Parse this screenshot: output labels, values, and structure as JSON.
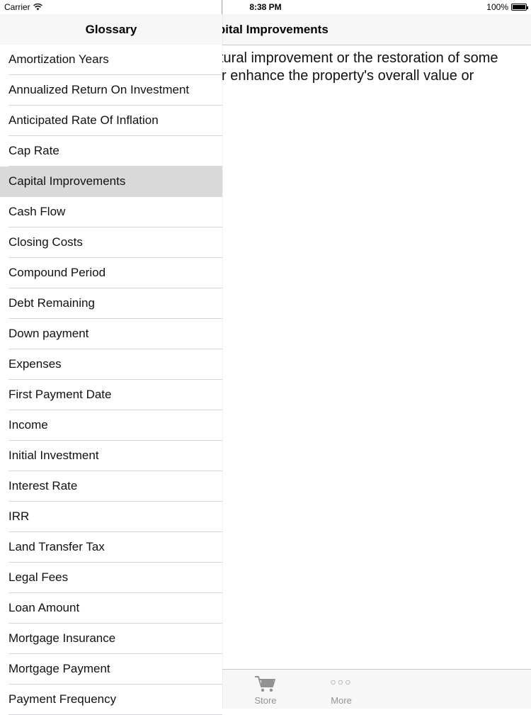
{
  "status_bar": {
    "carrier": "Carrier",
    "time": "8:38 PM",
    "battery": "100%"
  },
  "detail": {
    "title": "Capital Improvements",
    "title_visible": "pital Improvements",
    "body_line1": "tural improvement or the restoration of some",
    "body_line2": "r enhance the property's overall value or"
  },
  "tab_bar": {
    "store_label": "Store",
    "more_label": "More",
    "inactive_color": "#929292"
  },
  "glossary": {
    "title": "Glossary",
    "selected_index": 4,
    "items": [
      {
        "label": "Amortization Years"
      },
      {
        "label": "Annualized Return On Investment"
      },
      {
        "label": "Anticipated Rate Of Inflation"
      },
      {
        "label": "Cap Rate"
      },
      {
        "label": "Capital Improvements"
      },
      {
        "label": "Cash Flow"
      },
      {
        "label": "Closing Costs"
      },
      {
        "label": "Compound Period"
      },
      {
        "label": "Debt Remaining"
      },
      {
        "label": "Down payment"
      },
      {
        "label": "Expenses"
      },
      {
        "label": "First Payment Date"
      },
      {
        "label": "Income"
      },
      {
        "label": "Initial Investment"
      },
      {
        "label": "Interest Rate"
      },
      {
        "label": "IRR"
      },
      {
        "label": "Land Transfer Tax"
      },
      {
        "label": "Legal Fees"
      },
      {
        "label": "Loan Amount"
      },
      {
        "label": "Mortgage Insurance"
      },
      {
        "label": "Mortgage Payment"
      },
      {
        "label": "Payment Frequency"
      }
    ]
  },
  "colors": {
    "selected_row": "#d9d9d9",
    "nav_background": "#f7f7f8",
    "separator": "#d6d6da"
  }
}
